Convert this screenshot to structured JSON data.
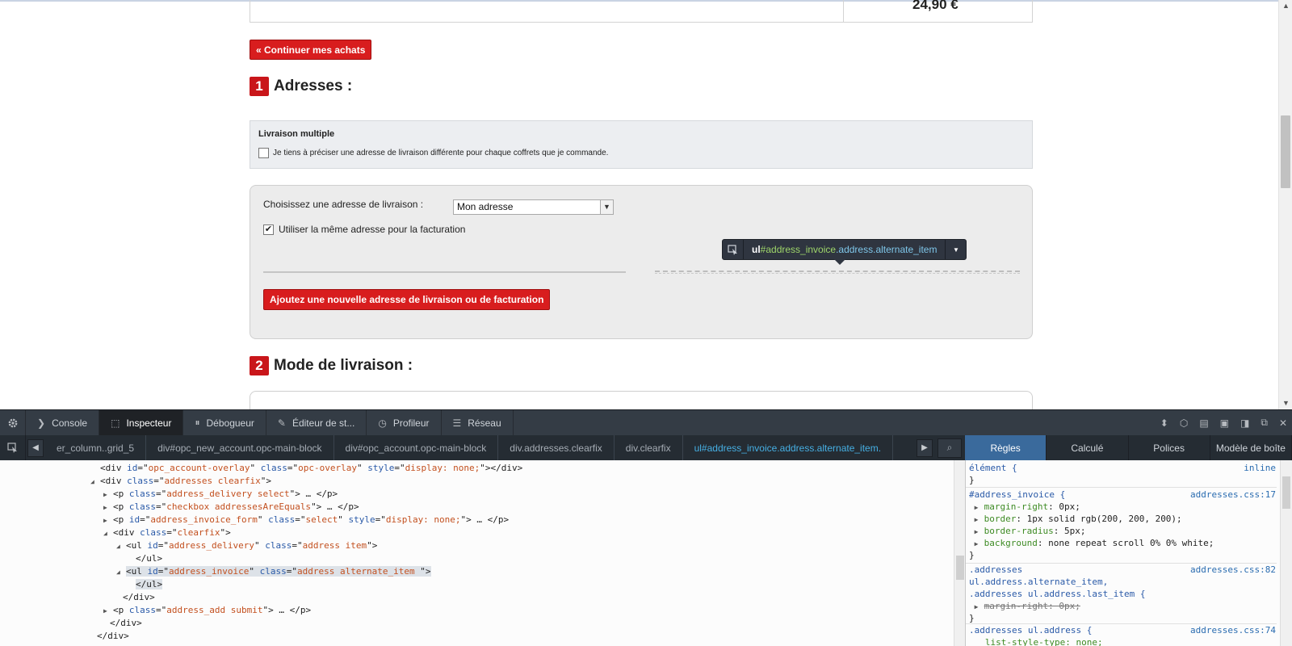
{
  "page": {
    "cart_total": "24,90 €",
    "continue_label": "« Continuer mes achats",
    "step1": {
      "num": "1",
      "title": "Adresses :"
    },
    "step2": {
      "num": "2",
      "title": "Mode de livraison :"
    },
    "multi": {
      "title": "Livraison multiple",
      "checkbox_label": "Je tiens à préciser une adresse de livraison différente pour chaque coffrets que je commande.",
      "checked": false
    },
    "address": {
      "choose_label": "Choisissez une adresse de livraison :",
      "selected": "Mon adresse",
      "same_label": "Utiliser la même adresse pour la facturation",
      "same_checked": true,
      "add_button": "Ajoutez une nouvelle adresse de livraison ou de facturation"
    },
    "tooltip": {
      "tag": "ul",
      "id": "#address_invoice",
      "classes": ".address.alternate_item"
    }
  },
  "devtools": {
    "tabs": [
      {
        "label": "Console",
        "icon": "console-icon"
      },
      {
        "label": "Inspecteur",
        "icon": "inspector-icon",
        "active": true
      },
      {
        "label": "Débogueur",
        "icon": "debugger-icon"
      },
      {
        "label": "Éditeur de st...",
        "icon": "style-editor-icon"
      },
      {
        "label": "Profileur",
        "icon": "profiler-icon"
      },
      {
        "label": "Réseau",
        "icon": "network-icon"
      }
    ],
    "breadcrumbs": [
      {
        "text": "er_column..grid_5"
      },
      {
        "text": "div#opc_new_account.opc-main-block"
      },
      {
        "text": "div#opc_account.opc-main-block"
      },
      {
        "text": "div.addresses.clearfix"
      },
      {
        "text": "div.clearfix"
      },
      {
        "text": "ul#address_invoice.address.alternate_item.",
        "selected": true
      }
    ],
    "side_tabs": [
      "Règles",
      "Calculé",
      "Polices",
      "Modèle de boîte"
    ],
    "markup": [
      {
        "indent": 112,
        "tw": "",
        "text": "<div id=\"opc_account-overlay\" class=\"opc-overlay\" style=\"display: none;\"></div>"
      },
      {
        "indent": 112,
        "tw": "◢",
        "text": "<div class=\"addresses clearfix\">"
      },
      {
        "indent": 128,
        "tw": "▶",
        "text": "<p class=\"address_delivery select\"> … </p>"
      },
      {
        "indent": 128,
        "tw": "▶",
        "text": "<p class=\"checkbox addressesAreEquals\"> … </p>"
      },
      {
        "indent": 128,
        "tw": "▶",
        "text": "<p id=\"address_invoice_form\" class=\"select\" style=\"display: none;\"> … </p>"
      },
      {
        "indent": 128,
        "tw": "◢",
        "text": "<div class=\"clearfix\">"
      },
      {
        "indent": 144,
        "tw": "◢",
        "text": "<ul id=\"address_delivery\" class=\"address item\">"
      },
      {
        "indent": 156,
        "tw": "",
        "text": "</ul>"
      },
      {
        "indent": 144,
        "tw": "◢",
        "text": "<ul id=\"address_invoice\" class=\"address alternate_item \">",
        "highlight": true
      },
      {
        "indent": 156,
        "tw": "",
        "text": "</ul>",
        "highlight": true
      },
      {
        "indent": 140,
        "tw": "",
        "text": "</div>"
      },
      {
        "indent": 128,
        "tw": "▶",
        "text": "<p class=\"address_add submit\"> … </p>"
      },
      {
        "indent": 124,
        "tw": "",
        "text": "</div>"
      },
      {
        "indent": 108,
        "tw": "",
        "text": "</div>"
      }
    ],
    "rules": {
      "element": {
        "selector": "élément {",
        "source": "inline",
        "close": "}"
      },
      "r1": {
        "selector": "#address_invoice {",
        "source": "addresses.css:17",
        "props": [
          {
            "name": "margin-right",
            "value": "0px;"
          },
          {
            "name": "border",
            "value": "1px solid rgb(200, 200, 200);"
          },
          {
            "name": "border-radius",
            "value": "5px;"
          },
          {
            "name": "background",
            "value": "none repeat scroll 0% 0% white;"
          }
        ],
        "close": "}"
      },
      "r2": {
        "selector_1": ".addresses",
        "selector_2": "ul.address.alternate_item,",
        "selector_3": ".addresses ul.address.last_item {",
        "source": "addresses.css:82",
        "prop": "margin-right: 0px;",
        "close": "}"
      },
      "r3": {
        "selector": ".addresses ul.address {",
        "source": "addresses.css:74",
        "prop": "list-style-type: none;"
      }
    }
  }
}
